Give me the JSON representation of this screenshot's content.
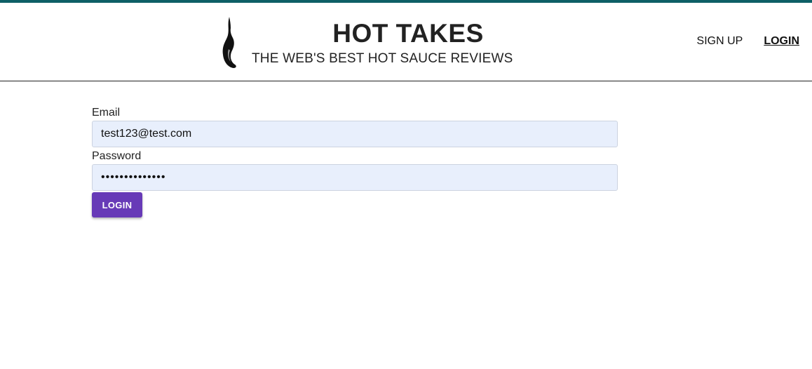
{
  "colors": {
    "accent_bar": "#0e5f66",
    "button_bg": "#673ab7",
    "input_bg": "#e8effc"
  },
  "header": {
    "logo_icon": "flame-icon",
    "title": "HOT TAKES",
    "tagline": "THE WEB'S BEST HOT SAUCE REVIEWS"
  },
  "nav": {
    "signup_label": "SIGN UP",
    "login_label": "LOGIN"
  },
  "form": {
    "email_label": "Email",
    "email_value": "test123@test.com",
    "password_label": "Password",
    "password_value": "••••••••••••••",
    "submit_label": "LOGIN"
  }
}
